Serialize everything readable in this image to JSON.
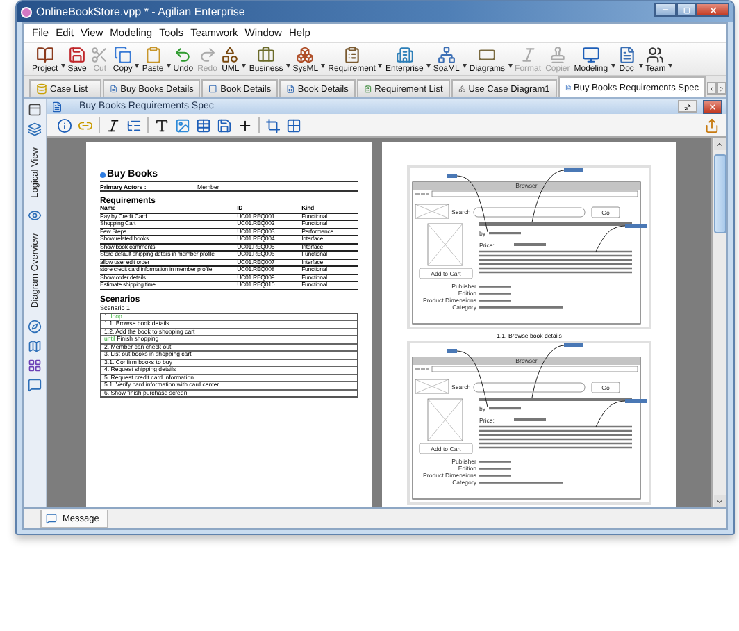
{
  "window": {
    "title": "OnlineBookStore.vpp * - Agilian Enterprise"
  },
  "menu": [
    "File",
    "Edit",
    "View",
    "Modeling",
    "Tools",
    "Teamwork",
    "Window",
    "Help"
  ],
  "toolbar": [
    {
      "label": "Project",
      "disabled": false,
      "dropdown": true
    },
    {
      "label": "Save",
      "disabled": false,
      "dropdown": false
    },
    {
      "label": "Cut",
      "disabled": true,
      "dropdown": false
    },
    {
      "label": "Copy",
      "disabled": false,
      "dropdown": true
    },
    {
      "label": "Paste",
      "disabled": false,
      "dropdown": true
    },
    {
      "label": "Undo",
      "disabled": false,
      "dropdown": false
    },
    {
      "label": "Redo",
      "disabled": true,
      "dropdown": false
    },
    {
      "label": "UML",
      "disabled": false,
      "dropdown": true
    },
    {
      "label": "Business",
      "disabled": false,
      "dropdown": true
    },
    {
      "label": "SysML",
      "disabled": false,
      "dropdown": true
    },
    {
      "label": "Requirement",
      "disabled": false,
      "dropdown": true
    },
    {
      "label": "Enterprise",
      "disabled": false,
      "dropdown": true
    },
    {
      "label": "SoaML",
      "disabled": false,
      "dropdown": true
    },
    {
      "label": "Diagrams",
      "disabled": false,
      "dropdown": true
    },
    {
      "label": "Format",
      "disabled": true,
      "dropdown": false
    },
    {
      "label": "Copier",
      "disabled": true,
      "dropdown": false
    },
    {
      "label": "Modeling",
      "disabled": false,
      "dropdown": true
    },
    {
      "label": "Doc",
      "disabled": false,
      "dropdown": true
    },
    {
      "label": "Team",
      "disabled": false,
      "dropdown": true
    }
  ],
  "tabs": [
    {
      "label": "Case List",
      "selected": false
    },
    {
      "label": "Buy Books Details",
      "selected": false
    },
    {
      "label": "Book Details",
      "selected": false
    },
    {
      "label": "Book Details",
      "selected": false
    },
    {
      "label": "Requirement List",
      "selected": false
    },
    {
      "label": "Use Case Diagram1",
      "selected": false
    },
    {
      "label": "Buy Books Requirements Spec",
      "selected": true
    }
  ],
  "side_panel": {
    "labels": [
      "Logical View",
      "Diagram Overview"
    ]
  },
  "editor": {
    "title": "Buy Books Requirements Spec"
  },
  "document": {
    "heading": "Buy Books",
    "primary_actors_label": "Primary Actors :",
    "primary_actors": "Member",
    "requirements_title": "Requirements",
    "columns": [
      "Name",
      "ID",
      "Kind"
    ],
    "requirements": [
      [
        "Pay by Credit Card",
        "UC01.REQ001",
        "Functional"
      ],
      [
        "Shopping Cart",
        "UC01.REQ002",
        "Functional"
      ],
      [
        "Few Steps",
        "UC01.REQ003",
        "Performance"
      ],
      [
        "Show related books",
        "UC01.REQ004",
        "Interface"
      ],
      [
        "Show book comments",
        "UC01.REQ005",
        "Interface"
      ],
      [
        "Store default shipping details in member profile",
        "UC01.REQ006",
        "Functional"
      ],
      [
        "allow user edit order",
        "UC01.REQ007",
        "Interface"
      ],
      [
        "store credit card information in member profile",
        "UC01.REQ008",
        "Functional"
      ],
      [
        "Show order details",
        "UC01.REQ009",
        "Functional"
      ],
      [
        "Estimate shipping time",
        "UC01.REQ010",
        "Functional"
      ]
    ],
    "scenarios_title": "Scenarios",
    "scenario_name": "Scenario 1",
    "steps": [
      {
        "number": "1.",
        "keyword": "loop"
      },
      {
        "number": "1.1.",
        "text": "Browse book details"
      },
      {
        "number": "1.2.",
        "text": "Add the book to shopping cart"
      },
      {
        "keyword": "until",
        "text": "Finish shopping"
      },
      {
        "number": "2.",
        "text": "Member can check out"
      },
      {
        "number": "3.",
        "text": "List out books in shopping cart"
      },
      {
        "number": "3.1.",
        "text": "Confirm books to buy"
      },
      {
        "number": "4.",
        "text": "Request shipping details"
      },
      {
        "number": "5.",
        "text": "Request credit card information"
      },
      {
        "number": "5.1.",
        "text": "Verify card information with card center"
      },
      {
        "number": "6.",
        "text": "Show finish purchase screen"
      }
    ]
  },
  "mockups": [
    {
      "window_title": "Browser",
      "search": "Search",
      "go": "Go",
      "price": "Price:",
      "by": "by",
      "add_to_cart": "Add to Cart",
      "fields": [
        "Publisher",
        "Edition",
        "Product Dimensions",
        "Category"
      ],
      "caption": "1.1. Browse book details"
    },
    {
      "window_title": "Browser",
      "search": "Search",
      "go": "Go",
      "price": "Price:",
      "by": "by",
      "add_to_cart": "Add to Cart",
      "fields": [
        "Publisher",
        "Edition",
        "Product Dimensions",
        "Category"
      ]
    }
  ],
  "bottom_tabs": [
    {
      "label": "Message",
      "selected": true
    }
  ]
}
